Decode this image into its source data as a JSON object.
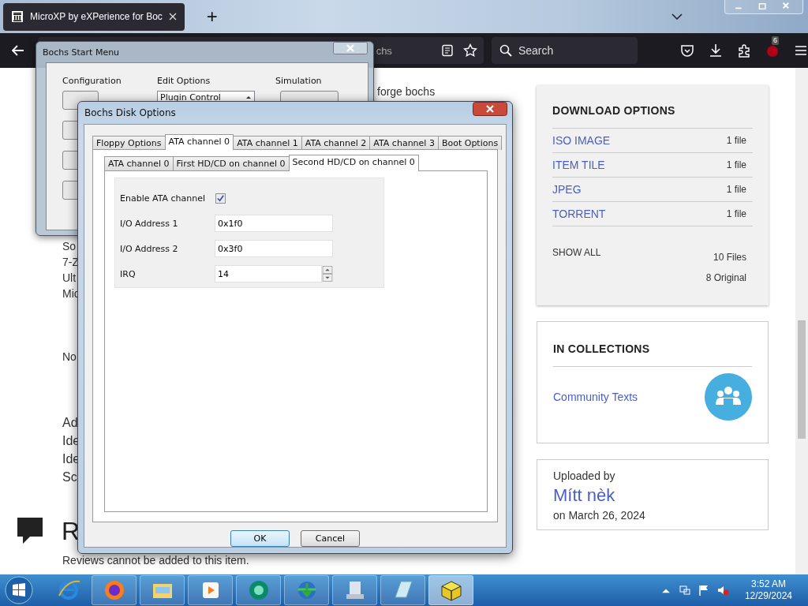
{
  "browser": {
    "tab": {
      "title": "MicroXP by eXPerience for Boc"
    },
    "new_tab": "+",
    "url_fragment": "chs",
    "search": {
      "placeholder": "Search"
    },
    "addon_badge": "6"
  },
  "page": {
    "top_fragment": "forge bochs",
    "left_fragments": [
      "So",
      "7-Z",
      "Ult",
      "Mic"
    ],
    "note_fragment": "No",
    "lower_fragments": [
      "Ad",
      "Ide",
      "Ide",
      "Sc"
    ],
    "reviews_heading": "R",
    "reviews_note": "Reviews cannot be added to this item.",
    "download_options": {
      "title": "DOWNLOAD OPTIONS",
      "items": [
        {
          "label": "ISO IMAGE",
          "count": "1 file"
        },
        {
          "label": "ITEM TILE",
          "count": "1 file"
        },
        {
          "label": "JPEG",
          "count": "1 file"
        },
        {
          "label": "TORRENT",
          "count": "1 file"
        }
      ],
      "show_all": "SHOW ALL",
      "files": "10 Files",
      "original": "8 Original"
    },
    "collections": {
      "title": "IN COLLECTIONS",
      "items": [
        "Community Texts"
      ]
    },
    "uploader": {
      "label": "Uploaded by",
      "name": "Mítt nèk",
      "date": "on March 26, 2024"
    }
  },
  "start_menu": {
    "title": "Bochs Start Menu",
    "groups": [
      "Configuration",
      "Edit Options",
      "Simulation"
    ],
    "dropdown": "Plugin Control"
  },
  "disk_options": {
    "title": "Bochs Disk Options",
    "tabs": [
      {
        "label": "Floppy Options",
        "selected": false
      },
      {
        "label": "ATA channel 0",
        "selected": true
      },
      {
        "label": "ATA channel 1",
        "selected": false
      },
      {
        "label": "ATA channel 2",
        "selected": false
      },
      {
        "label": "ATA channel 3",
        "selected": false
      },
      {
        "label": "Boot Options",
        "selected": false
      }
    ],
    "subtabs": [
      {
        "label": "ATA channel 0",
        "selected": false
      },
      {
        "label": "First HD/CD on channel 0",
        "selected": false
      },
      {
        "label": "Second HD/CD on channel 0",
        "selected": true
      }
    ],
    "fields": [
      {
        "kind": "checkbox",
        "label": "Enable ATA channel",
        "checked": true
      },
      {
        "kind": "text",
        "label": "I/O Address 1",
        "value": "0x1f0"
      },
      {
        "kind": "text",
        "label": "I/O Address 2",
        "value": "0x3f0"
      },
      {
        "kind": "spin",
        "label": "IRQ",
        "value": "14"
      }
    ],
    "buttons": [
      {
        "label": "OK",
        "default": true
      },
      {
        "label": "Cancel",
        "default": false
      }
    ]
  },
  "taskbar": {
    "time": "3:52 AM",
    "date": "12/29/2024"
  }
}
